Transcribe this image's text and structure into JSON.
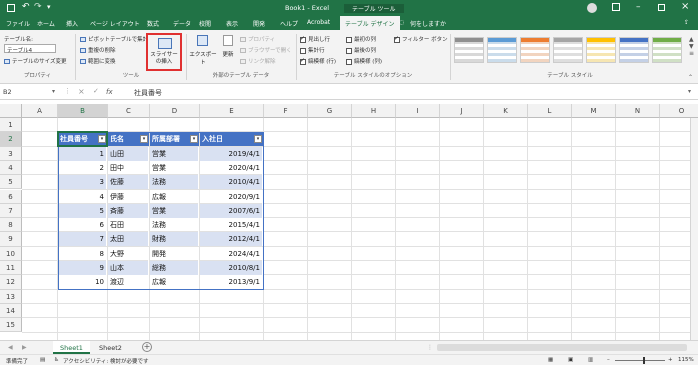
{
  "title": {
    "doc": "Book1 - Excel",
    "tool": "テーブル ツール"
  },
  "tabs": [
    "ファイル",
    "ホーム",
    "挿入",
    "ページ レイアウト",
    "数式",
    "データ",
    "校閲",
    "表示",
    "開発",
    "ヘルプ",
    "Acrobat",
    "テーブル デザイン"
  ],
  "tell_me": "何をしますか",
  "ribbon": {
    "table_name_label": "テーブル名:",
    "table_name_value": "テーブル4",
    "resize": "テーブルのサイズ変更",
    "grp_props": "プロパティ",
    "pivot": "ピボットテーブルで集計",
    "dedupe": "重複の削除",
    "convert": "範囲に変換",
    "slicer": "スライサーの挿入",
    "grp_tools": "ツール",
    "export": "エクスポート",
    "refresh": "更新",
    "properties": "プロパティ",
    "browser": "ブラウザーで開く",
    "unlink": "リンク解除",
    "grp_ext": "外部のテーブル データ",
    "opt_header": "見出し行",
    "opt_total": "集計行",
    "opt_banded_rows": "縞模様 (行)",
    "opt_first_col": "最初の列",
    "opt_last_col": "最後の列",
    "opt_banded_cols": "縞模様 (列)",
    "opt_filter": "フィルター ボタン",
    "grp_opts": "テーブル スタイルのオプション",
    "grp_styles": "テーブル スタイル"
  },
  "namebox": "B2",
  "fx": "fx",
  "formula": "社員番号",
  "columns": [
    "A",
    "B",
    "C",
    "D",
    "E",
    "F",
    "G",
    "H",
    "I",
    "J",
    "K",
    "L",
    "M",
    "N",
    "O"
  ],
  "rows": [
    "1",
    "2",
    "3",
    "4",
    "5",
    "6",
    "7",
    "8",
    "9",
    "10",
    "11",
    "12",
    "13",
    "14",
    "15"
  ],
  "table": {
    "headers": [
      "社員番号",
      "氏名",
      "所属部署",
      "入社日"
    ],
    "rows": [
      [
        "1",
        "山田",
        "営業",
        "2019/4/1"
      ],
      [
        "2",
        "田中",
        "営業",
        "2020/4/1"
      ],
      [
        "3",
        "佐藤",
        "法務",
        "2010/4/1"
      ],
      [
        "4",
        "伊藤",
        "広報",
        "2020/9/1"
      ],
      [
        "5",
        "斉藤",
        "営業",
        "2007/6/1"
      ],
      [
        "6",
        "石田",
        "法務",
        "2015/4/1"
      ],
      [
        "7",
        "太田",
        "財務",
        "2012/4/1"
      ],
      [
        "8",
        "大野",
        "開発",
        "2024/4/1"
      ],
      [
        "9",
        "山本",
        "総務",
        "2010/8/1"
      ],
      [
        "10",
        "渡辺",
        "広報",
        "2013/9/1"
      ]
    ]
  },
  "sheets": [
    "Sheet1",
    "Sheet2"
  ],
  "status": {
    "ready": "準備完了",
    "access": "アクセシビリティ: 検討が必要です",
    "zoom": "115%"
  }
}
